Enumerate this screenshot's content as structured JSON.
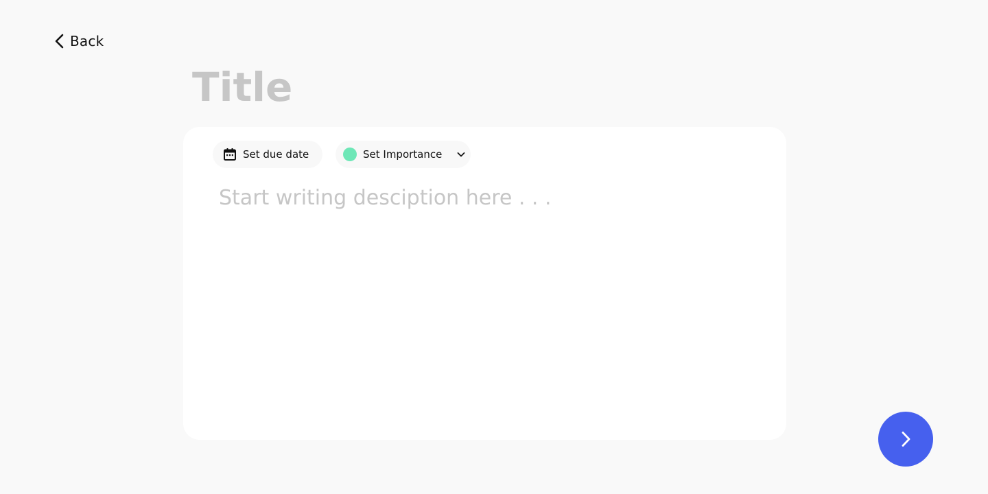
{
  "header": {
    "back_label": "Back",
    "back_icon": "chevron-left-icon"
  },
  "title_field": {
    "value": "",
    "placeholder": "Title"
  },
  "toolbar": {
    "due_date_label": "Set due date",
    "due_date_icon": "calendar-icon",
    "importance_label": "Set Importance",
    "importance_dot_color": "#6ee7b7",
    "importance_dropdown_icon": "chevron-down-icon"
  },
  "description_field": {
    "value": "",
    "placeholder": "Start writing desciption here . . ."
  },
  "next_button": {
    "icon": "chevron-right-icon",
    "color": "#4660ee"
  }
}
